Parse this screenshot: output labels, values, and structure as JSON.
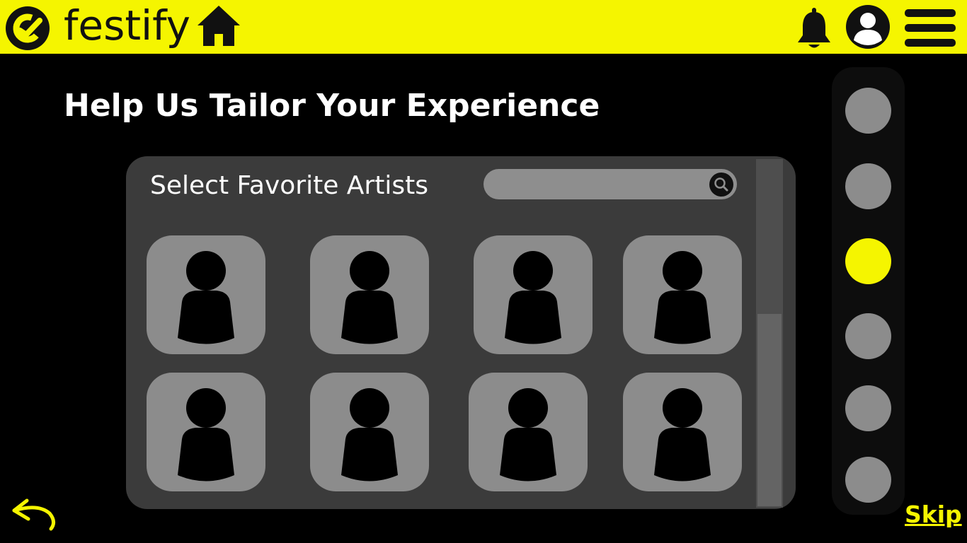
{
  "header": {
    "brand": "festify",
    "icons": [
      "logo-icon",
      "home-icon",
      "bell-icon",
      "user-avatar-icon",
      "menu-icon"
    ],
    "accent_color": "#f5f500"
  },
  "page": {
    "heading": "Help Us Tailor Your Experience"
  },
  "artist_panel": {
    "title": "Select Favorite Artists",
    "search_placeholder": "",
    "cards": [
      {
        "icon": "person-icon"
      },
      {
        "icon": "person-icon"
      },
      {
        "icon": "person-icon"
      },
      {
        "icon": "person-icon"
      },
      {
        "icon": "person-icon"
      },
      {
        "icon": "person-icon"
      },
      {
        "icon": "person-icon"
      },
      {
        "icon": "person-icon"
      }
    ]
  },
  "steps": {
    "count": 6,
    "active_index": 2
  },
  "footer": {
    "skip_label": "Skip",
    "back_icon": "undo-arrow-icon"
  }
}
